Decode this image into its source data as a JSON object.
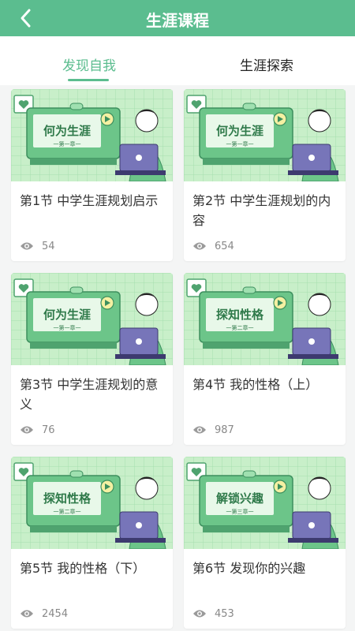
{
  "header": {
    "title": "生涯课程"
  },
  "tabs": [
    {
      "label": "发现自我"
    },
    {
      "label": "生涯探索"
    }
  ],
  "cards": [
    {
      "title": "第1节  中学生涯规划启示",
      "views": "54",
      "thumb_title": "何为生涯",
      "thumb_sub": "一第一章一"
    },
    {
      "title": "第2节  中学生涯规划的内容",
      "views": "654",
      "thumb_title": "何为生涯",
      "thumb_sub": "一第一章一"
    },
    {
      "title": "第3节  中学生涯规划的意义",
      "views": "76",
      "thumb_title": "何为生涯",
      "thumb_sub": "一第一章一"
    },
    {
      "title": "第4节  我的性格（上）",
      "views": "987",
      "thumb_title": "探知性格",
      "thumb_sub": "一第二章一"
    },
    {
      "title": "第5节  我的性格（下）",
      "views": "2454",
      "thumb_title": "探知性格",
      "thumb_sub": "一第二章一"
    },
    {
      "title": "第6节  发现你的兴趣",
      "views": "453",
      "thumb_title": "解锁兴趣",
      "thumb_sub": "一第三章一"
    }
  ],
  "colors": {
    "accent": "#5bbd8f",
    "thumb_bg": "#c8efc9",
    "thumb_dark": "#4fa36f"
  }
}
